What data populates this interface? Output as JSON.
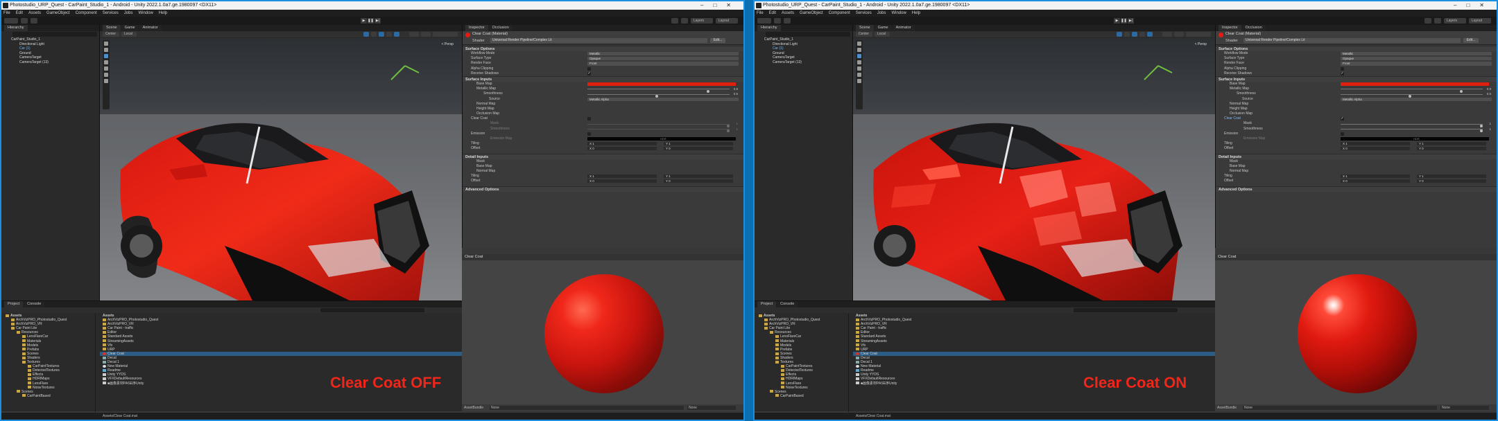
{
  "panes": [
    {
      "id": "off",
      "title": "Photostudio_URP_Quest - CarPaint_Studio_1 - Android - Unity 2022.1.0a7.ge.1980097 <DX11>",
      "material_name": "Clear Coat (Material)",
      "caption": "Clear Coat OFF",
      "clear_coat_enabled": false
    },
    {
      "id": "on",
      "title": "Photostudio_URP_Quest - CarPaint_Studio_1 - Android - Unity 2022.1.0a7.ge.1980097 <DX11>",
      "material_name": "Clear Coat (Material)",
      "caption": "Clear Coat ON",
      "clear_coat_enabled": true
    }
  ],
  "menu": [
    "File",
    "Edit",
    "Assets",
    "GameObject",
    "Component",
    "Services",
    "Jobs",
    "Window",
    "Help"
  ],
  "toolbar": {
    "layers": "Layers",
    "layout": "Layout"
  },
  "hierarchy": {
    "tab": "Hierarchy",
    "items": [
      "CarPaint_Studio_1",
      "Directional Light",
      "Car (1)",
      "Ground",
      "CameraTarget",
      "CameraTarget (13)"
    ]
  },
  "scene_tabs": [
    "Scene",
    "Game",
    "Animator"
  ],
  "scene_tools": [
    "Center",
    "Local"
  ],
  "gizmo": "< Persp",
  "inspector": {
    "tabs": [
      "Inspector",
      "Occlusion"
    ],
    "shader_label": "Shader",
    "shader_value": "Universal Render Pipeline/Complex Lit",
    "edit": "Edit...",
    "sections": {
      "surface_options": "Surface Options",
      "surface_inputs": "Surface Inputs",
      "detail_inputs": "Detail Inputs",
      "advanced": "Advanced Options"
    },
    "surface_options": [
      {
        "label": "Workflow Mode",
        "value": "Metallic"
      },
      {
        "label": "Surface Type",
        "value": "Opaque"
      },
      {
        "label": "Render Face",
        "value": "Front"
      },
      {
        "label": "Alpha Clipping",
        "value": ""
      },
      {
        "label": "Receive Shadows",
        "value": "✓"
      }
    ],
    "surface_inputs": {
      "base_map": "Base Map",
      "metallic_map": "Metallic Map",
      "metallic_value": "0.8",
      "smoothness": "Smoothness",
      "smoothness_value": "0.5",
      "source": "Source",
      "source_value": "Metallic Alpha",
      "normal_map": "Normal Map",
      "height_map": "Height Map",
      "occlusion_map": "Occlusion Map",
      "clear_coat": "Clear Coat",
      "mask": "Mask",
      "mask_value": "1",
      "cc_smoothness": "Smoothness",
      "cc_smoothness_value": "1",
      "emission": "Emission",
      "emission_map": "Emission Map",
      "hdr": "HDR",
      "tiling": "Tiling",
      "offset": "Offset",
      "x1": "X 1",
      "y1": "Y 1",
      "x0": "X 0",
      "y0": "Y 0"
    },
    "detail_inputs": {
      "mask": "Mask",
      "base_map": "Base Map",
      "normal_map": "Normal Map",
      "tiling": "Tiling",
      "offset": "Offset"
    }
  },
  "preview": {
    "label": "Clear Coat"
  },
  "bundle": {
    "label": "AssetBundle",
    "value": "None",
    "variant": "None"
  },
  "project": {
    "tabs": [
      "Project",
      "Console"
    ],
    "tree": [
      "Assets",
      "ArchVizPRO_Photostudio_Quest",
      "ArchVizPRO_VR",
      "Car Paint Lite",
      "Resources",
      "LensFlareCar",
      "Materials",
      "Models",
      "Prefabs",
      "Scenes",
      "Shaders",
      "Textures",
      "CarPaintTextures",
      "DetectedTextures",
      "Effects",
      "HDRIMaps",
      "LensFlare",
      "NoiseTextures",
      "Scenes",
      "CarPaintBased"
    ],
    "breadcrumb": "Assets",
    "items": [
      "ArchVizPRO_Photostudio_Quest",
      "ArchVizPRO_VR",
      "Car Paint - traffic",
      "Editor",
      "Standard Assets",
      "StreamingAssets",
      "Vfx",
      "URP",
      "Clear Coat",
      "Decal",
      "Decal 1",
      "New Material",
      "Readme",
      "Unity YYDS",
      "VFXDefaultResources",
      "■画像素材PASE序Unity"
    ],
    "selected": "Clear Coat",
    "path": "Assets/Clear Coat.mat"
  }
}
